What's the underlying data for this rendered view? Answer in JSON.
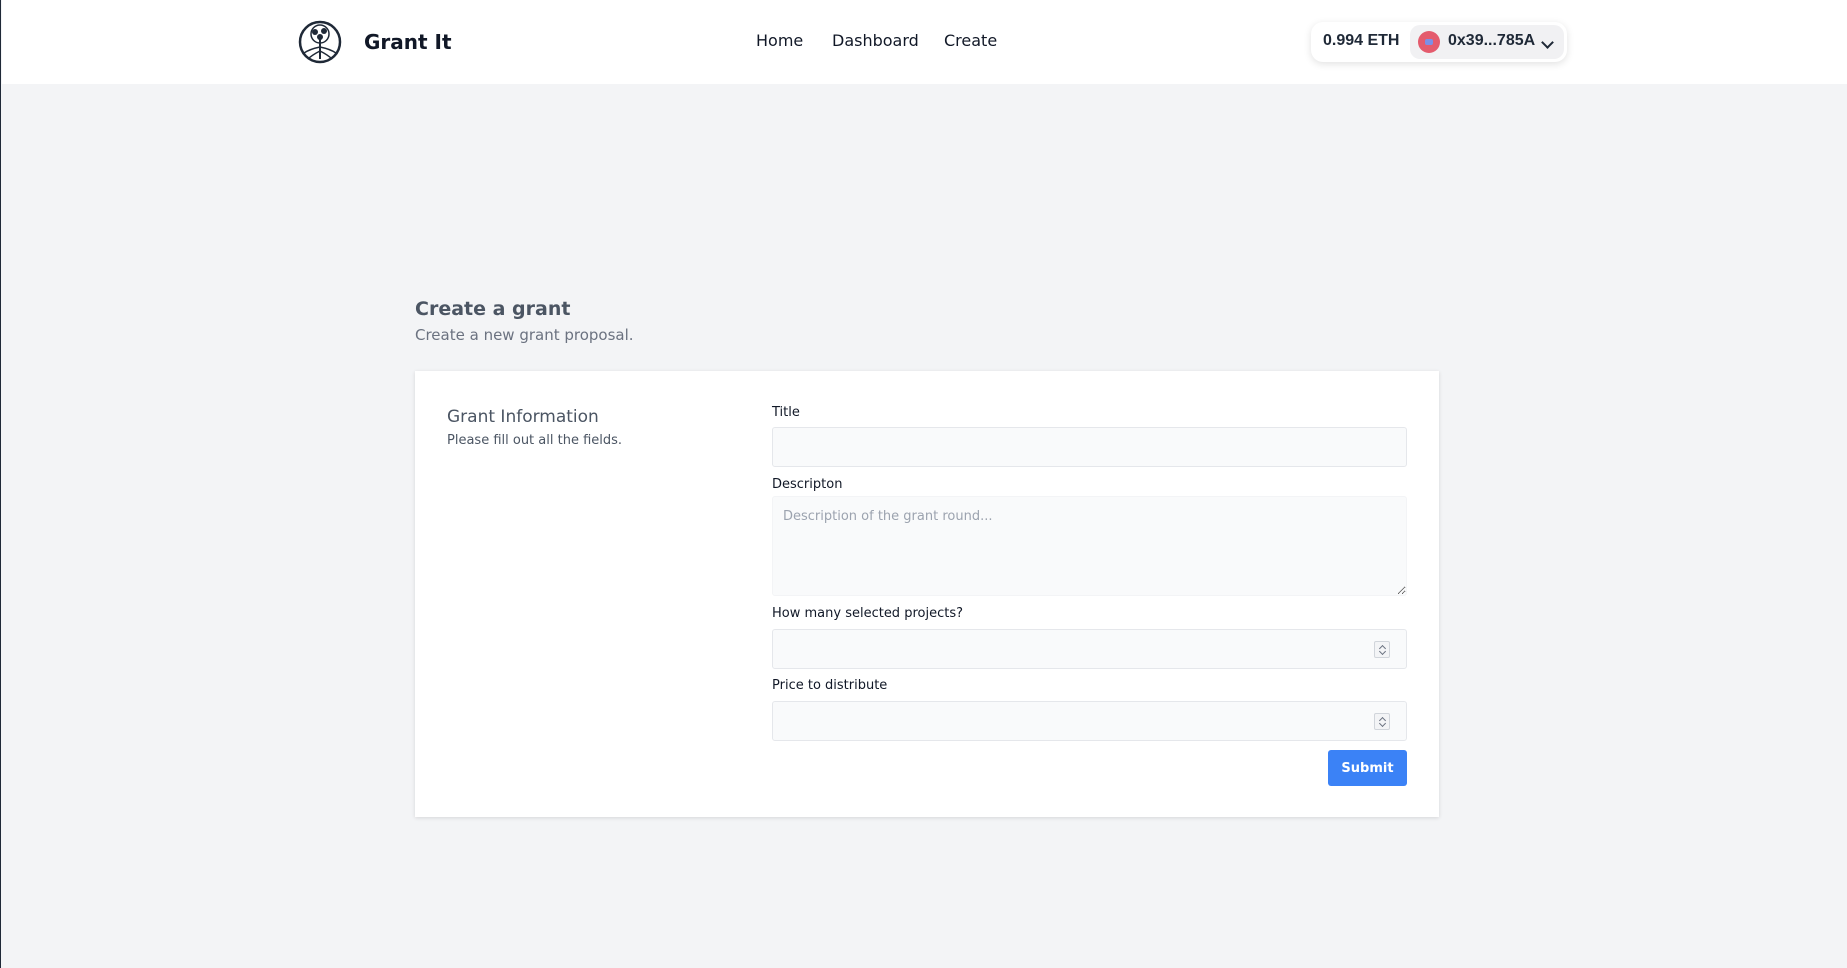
{
  "header": {
    "brand": "Grant It",
    "nav": {
      "home": "Home",
      "dashboard": "Dashboard",
      "create": "Create"
    },
    "wallet": {
      "balance": "0.994 ETH",
      "address": "0x39...785A"
    }
  },
  "page": {
    "title": "Create a grant",
    "subtitle": "Create a new grant proposal."
  },
  "form": {
    "section_title": "Grant Information",
    "section_subtitle": "Please fill out all the fields.",
    "title_label": "Title",
    "title_value": "",
    "description_label": "Descripton",
    "description_placeholder": "Description of the grant round...",
    "projects_label": "How many selected projects?",
    "projects_value": "",
    "price_label": "Price to distribute",
    "price_value": "",
    "submit_label": "Submit"
  },
  "colors": {
    "accent": "#3b82f6",
    "background": "#f3f4f6",
    "avatar": "#e45b6d"
  }
}
